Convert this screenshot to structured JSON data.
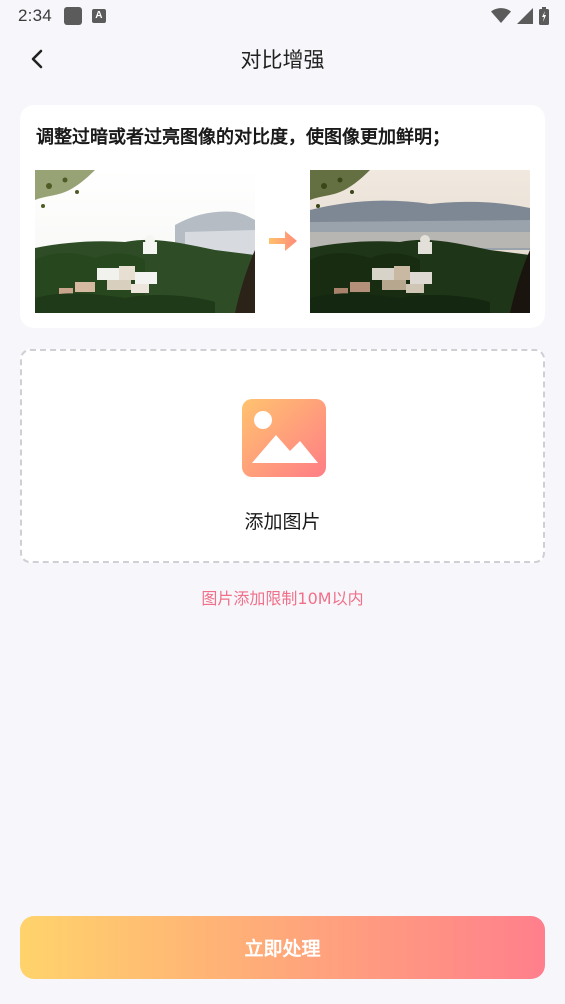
{
  "status_bar": {
    "time": "2:34"
  },
  "header": {
    "title": "对比增强",
    "back_icon": "chevron-left-icon"
  },
  "intro": {
    "description": "调整过暗或者过亮图像的对比度，使图像更加鲜明；",
    "arrow_icon": "arrow-right-icon"
  },
  "upload": {
    "icon": "image-icon",
    "label": "添加图片"
  },
  "limit_note": "图片添加限制10M以内",
  "action": {
    "process_label": "立即处理"
  },
  "colors": {
    "accent_start": "#ffd36b",
    "accent_end": "#ff7f8c",
    "note": "#f0708a",
    "background": "#f7f7fb"
  }
}
